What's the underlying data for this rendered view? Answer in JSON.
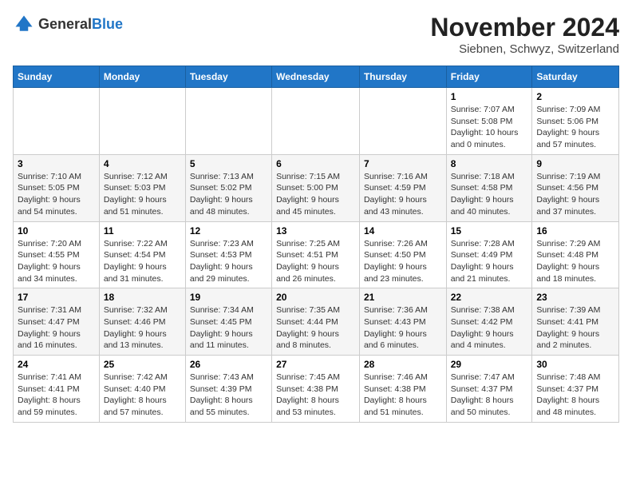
{
  "logo": {
    "text_general": "General",
    "text_blue": "Blue"
  },
  "header": {
    "month_title": "November 2024",
    "location": "Siebnen, Schwyz, Switzerland"
  },
  "days_of_week": [
    "Sunday",
    "Monday",
    "Tuesday",
    "Wednesday",
    "Thursday",
    "Friday",
    "Saturday"
  ],
  "weeks": [
    [
      {
        "day": "",
        "info": ""
      },
      {
        "day": "",
        "info": ""
      },
      {
        "day": "",
        "info": ""
      },
      {
        "day": "",
        "info": ""
      },
      {
        "day": "",
        "info": ""
      },
      {
        "day": "1",
        "info": "Sunrise: 7:07 AM\nSunset: 5:08 PM\nDaylight: 10 hours and 0 minutes."
      },
      {
        "day": "2",
        "info": "Sunrise: 7:09 AM\nSunset: 5:06 PM\nDaylight: 9 hours and 57 minutes."
      }
    ],
    [
      {
        "day": "3",
        "info": "Sunrise: 7:10 AM\nSunset: 5:05 PM\nDaylight: 9 hours and 54 minutes."
      },
      {
        "day": "4",
        "info": "Sunrise: 7:12 AM\nSunset: 5:03 PM\nDaylight: 9 hours and 51 minutes."
      },
      {
        "day": "5",
        "info": "Sunrise: 7:13 AM\nSunset: 5:02 PM\nDaylight: 9 hours and 48 minutes."
      },
      {
        "day": "6",
        "info": "Sunrise: 7:15 AM\nSunset: 5:00 PM\nDaylight: 9 hours and 45 minutes."
      },
      {
        "day": "7",
        "info": "Sunrise: 7:16 AM\nSunset: 4:59 PM\nDaylight: 9 hours and 43 minutes."
      },
      {
        "day": "8",
        "info": "Sunrise: 7:18 AM\nSunset: 4:58 PM\nDaylight: 9 hours and 40 minutes."
      },
      {
        "day": "9",
        "info": "Sunrise: 7:19 AM\nSunset: 4:56 PM\nDaylight: 9 hours and 37 minutes."
      }
    ],
    [
      {
        "day": "10",
        "info": "Sunrise: 7:20 AM\nSunset: 4:55 PM\nDaylight: 9 hours and 34 minutes."
      },
      {
        "day": "11",
        "info": "Sunrise: 7:22 AM\nSunset: 4:54 PM\nDaylight: 9 hours and 31 minutes."
      },
      {
        "day": "12",
        "info": "Sunrise: 7:23 AM\nSunset: 4:53 PM\nDaylight: 9 hours and 29 minutes."
      },
      {
        "day": "13",
        "info": "Sunrise: 7:25 AM\nSunset: 4:51 PM\nDaylight: 9 hours and 26 minutes."
      },
      {
        "day": "14",
        "info": "Sunrise: 7:26 AM\nSunset: 4:50 PM\nDaylight: 9 hours and 23 minutes."
      },
      {
        "day": "15",
        "info": "Sunrise: 7:28 AM\nSunset: 4:49 PM\nDaylight: 9 hours and 21 minutes."
      },
      {
        "day": "16",
        "info": "Sunrise: 7:29 AM\nSunset: 4:48 PM\nDaylight: 9 hours and 18 minutes."
      }
    ],
    [
      {
        "day": "17",
        "info": "Sunrise: 7:31 AM\nSunset: 4:47 PM\nDaylight: 9 hours and 16 minutes."
      },
      {
        "day": "18",
        "info": "Sunrise: 7:32 AM\nSunset: 4:46 PM\nDaylight: 9 hours and 13 minutes."
      },
      {
        "day": "19",
        "info": "Sunrise: 7:34 AM\nSunset: 4:45 PM\nDaylight: 9 hours and 11 minutes."
      },
      {
        "day": "20",
        "info": "Sunrise: 7:35 AM\nSunset: 4:44 PM\nDaylight: 9 hours and 8 minutes."
      },
      {
        "day": "21",
        "info": "Sunrise: 7:36 AM\nSunset: 4:43 PM\nDaylight: 9 hours and 6 minutes."
      },
      {
        "day": "22",
        "info": "Sunrise: 7:38 AM\nSunset: 4:42 PM\nDaylight: 9 hours and 4 minutes."
      },
      {
        "day": "23",
        "info": "Sunrise: 7:39 AM\nSunset: 4:41 PM\nDaylight: 9 hours and 2 minutes."
      }
    ],
    [
      {
        "day": "24",
        "info": "Sunrise: 7:41 AM\nSunset: 4:41 PM\nDaylight: 8 hours and 59 minutes."
      },
      {
        "day": "25",
        "info": "Sunrise: 7:42 AM\nSunset: 4:40 PM\nDaylight: 8 hours and 57 minutes."
      },
      {
        "day": "26",
        "info": "Sunrise: 7:43 AM\nSunset: 4:39 PM\nDaylight: 8 hours and 55 minutes."
      },
      {
        "day": "27",
        "info": "Sunrise: 7:45 AM\nSunset: 4:38 PM\nDaylight: 8 hours and 53 minutes."
      },
      {
        "day": "28",
        "info": "Sunrise: 7:46 AM\nSunset: 4:38 PM\nDaylight: 8 hours and 51 minutes."
      },
      {
        "day": "29",
        "info": "Sunrise: 7:47 AM\nSunset: 4:37 PM\nDaylight: 8 hours and 50 minutes."
      },
      {
        "day": "30",
        "info": "Sunrise: 7:48 AM\nSunset: 4:37 PM\nDaylight: 8 hours and 48 minutes."
      }
    ]
  ]
}
